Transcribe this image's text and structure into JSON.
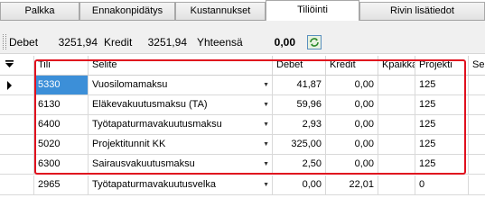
{
  "tabs": [
    {
      "label": "Palkka",
      "active": false
    },
    {
      "label": "Ennakonpidätys",
      "active": false
    },
    {
      "label": "Kustannukset",
      "active": false
    },
    {
      "label": "Tiliöinti",
      "active": true
    },
    {
      "label": "Rivin lisätiedot",
      "active": false
    }
  ],
  "summary": {
    "debet_label": "Debet",
    "debet_value": "3251,94",
    "kredit_label": "Kredit",
    "kredit_value": "3251,94",
    "total_label": "Yhteensä",
    "total_value": "0,00",
    "refresh_icon": "refresh-icon"
  },
  "grid": {
    "columns": [
      "Tili",
      "Selite",
      "Debet",
      "Kredit",
      "Kpaikka",
      "Projekti",
      "Se"
    ],
    "rows": [
      {
        "tili": "5330",
        "selite": "Vuosilomamaksu",
        "debet": "41,87",
        "kredit": "0,00",
        "kpaikka": "",
        "projekti": "125",
        "current": true
      },
      {
        "tili": "6130",
        "selite": "Eläkevakuutusmaksu (TA)",
        "debet": "59,96",
        "kredit": "0,00",
        "kpaikka": "",
        "projekti": "125",
        "current": false
      },
      {
        "tili": "6400",
        "selite": "Työtapaturmavakuutusmaksu",
        "debet": "2,93",
        "kredit": "0,00",
        "kpaikka": "",
        "projekti": "125",
        "current": false
      },
      {
        "tili": "5020",
        "selite": "Projektitunnit KK",
        "debet": "325,00",
        "kredit": "0,00",
        "kpaikka": "",
        "projekti": "125",
        "current": false
      },
      {
        "tili": "6300",
        "selite": "Sairausvakuutusmaksu",
        "debet": "2,50",
        "kredit": "0,00",
        "kpaikka": "",
        "projekti": "125",
        "current": false
      },
      {
        "tili": "2965",
        "selite": "Työtapaturmavakuutusvelka",
        "debet": "0,00",
        "kredit": "22,01",
        "kpaikka": "",
        "projekti": "0",
        "current": false
      }
    ]
  },
  "colors": {
    "highlight_box": "#e0101e",
    "current_cell": "#3c8fd8"
  }
}
